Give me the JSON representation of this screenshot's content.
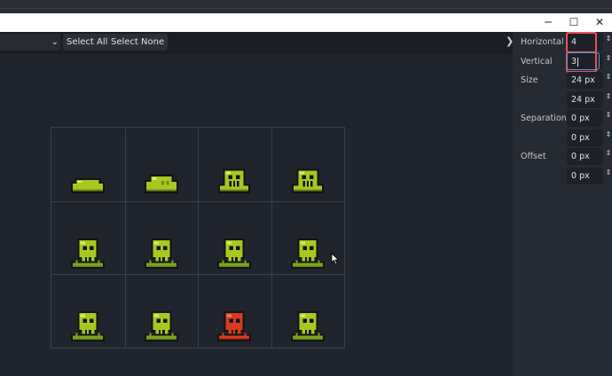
{
  "window": {
    "minimize_glyph": "─",
    "maximize_glyph": "☐",
    "close_glyph": "✕"
  },
  "toolbar": {
    "dropdown_chevron": "⌄",
    "select_all_label": "Select All",
    "select_none_label": "Select None"
  },
  "panel": {
    "collapse_glyph": "❯",
    "horizontal_label": "Horizontal",
    "horizontal_value": "4",
    "vertical_label": "Vertical",
    "vertical_value": "3",
    "size_label": "Size",
    "size_x": "24 px",
    "size_y": "24 px",
    "separation_label": "Separation",
    "separation_x": "0 px",
    "separation_y": "0 px",
    "offset_label": "Offset",
    "offset_x": "0 px",
    "offset_y": "0 px",
    "spin_glyph": "⇕"
  },
  "sprites": {
    "columns": 4,
    "rows": 3,
    "cells": [
      "slime-flat",
      "slime-small",
      "slime-skull",
      "slime-skull",
      "slime-drip",
      "slime-drip",
      "slime-drip",
      "slime-drip",
      "slime-drip",
      "slime-drip",
      "slime-red",
      "slime-drip"
    ],
    "colors": {
      "slime": "#a7c81f",
      "slime_dark": "#6f8c12",
      "slime_light": "#d4ec6b",
      "outline": "#141414",
      "red": "#d93a22",
      "red_dark": "#8c1d0f",
      "grass": "#7aa51b",
      "grid_line": "#3b3f47",
      "highlight": "#e8515f",
      "focus": "#5d8fd8"
    }
  }
}
